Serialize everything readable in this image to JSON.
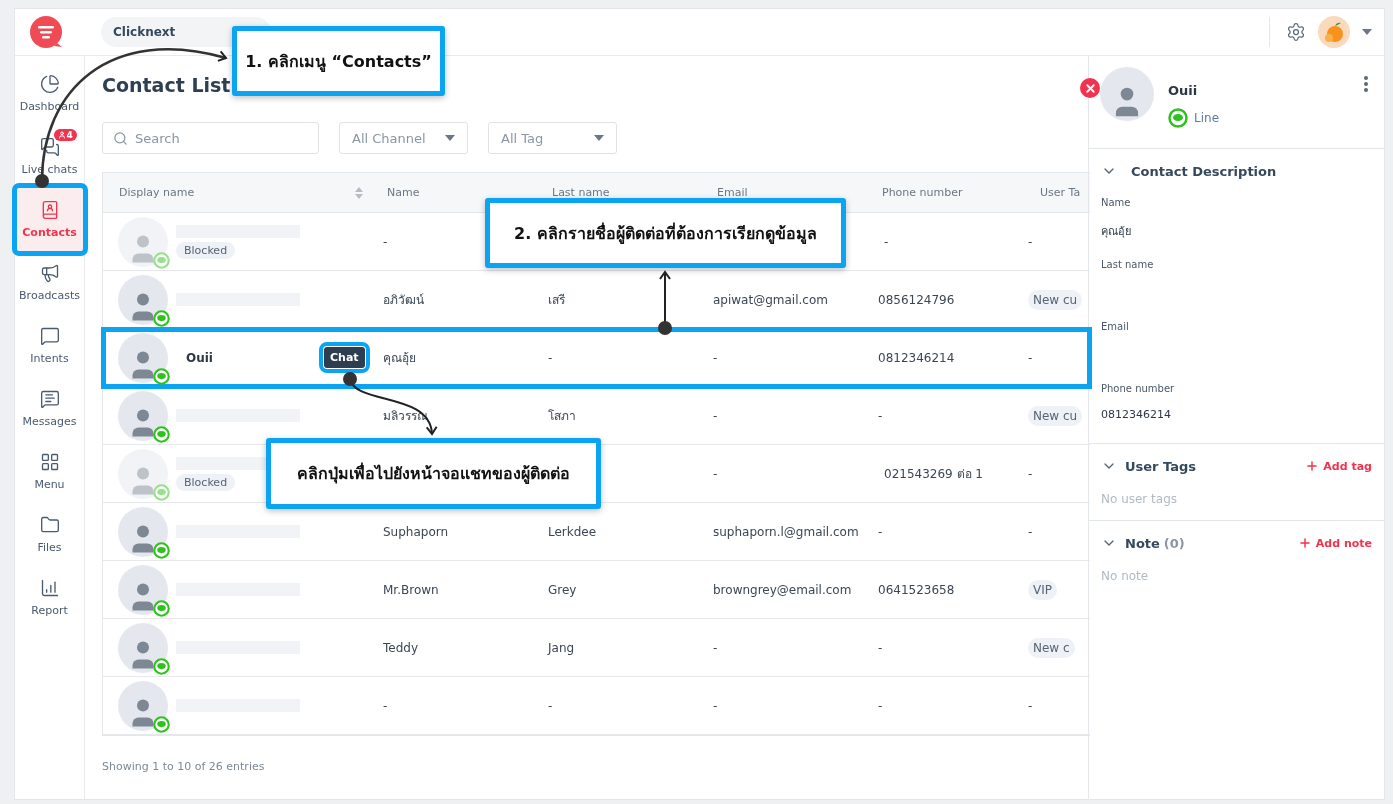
{
  "header": {
    "workspace": "Clicknext"
  },
  "sidebar": {
    "items": [
      {
        "label": "Dashboard",
        "selected": false,
        "highlighted": false
      },
      {
        "label": "Live chats",
        "badge": "4",
        "selected": false,
        "highlighted": false
      },
      {
        "label": "Contacts",
        "selected": true,
        "highlighted": true
      },
      {
        "label": "Broadcasts",
        "selected": false,
        "highlighted": false
      },
      {
        "label": "Intents",
        "selected": false,
        "highlighted": false
      },
      {
        "label": "Messages",
        "selected": false,
        "highlighted": false
      },
      {
        "label": "Menu",
        "selected": false,
        "highlighted": false
      },
      {
        "label": "Files",
        "selected": false,
        "highlighted": false
      },
      {
        "label": "Report",
        "selected": false,
        "highlighted": false
      }
    ]
  },
  "page_title": "Contact List",
  "filters": {
    "search_placeholder": "Search",
    "channel": "All Channel",
    "tag": "All Tag"
  },
  "table": {
    "columns": [
      "Display name",
      "Name",
      "Last name",
      "Email",
      "Phone number",
      "User Ta"
    ],
    "rows": [
      {
        "blocked": true,
        "badge": "Blocked",
        "name": "-",
        "phone": "-",
        "tag": "-",
        "highlighted": false
      },
      {
        "blocked": false,
        "name": "อภิวัฒน์",
        "last_name": "เสรี",
        "email": "apiwat@gmail.com",
        "phone": "0856124796",
        "tag": "New cu",
        "highlighted": false
      },
      {
        "blocked": false,
        "display_name": "Ouii",
        "chat": {
          "label": "Chat",
          "highlighted": true
        },
        "name": "คุณอุ้ย",
        "last_name": "-",
        "email": "-",
        "phone": "0812346214",
        "tag": "-",
        "highlighted": true
      },
      {
        "blocked": false,
        "name": "มลิวรรณ",
        "last_name": "โสภา",
        "email": "-",
        "phone": "-",
        "tag": "New cu",
        "highlighted": false
      },
      {
        "blocked": true,
        "badge": "Blocked",
        "email": "-",
        "phone": "021543269 ต่อ 1",
        "tag": "-",
        "highlighted": false
      },
      {
        "blocked": false,
        "name": "Suphaporn",
        "last_name": "Lerkdee",
        "email": "suphaporn.l@gmail.com",
        "phone": "-",
        "tag": "-",
        "highlighted": false
      },
      {
        "blocked": false,
        "name": "Mr.Brown",
        "last_name": "Grey",
        "email": "browngrey@email.com",
        "phone": "0641523658",
        "tag": "VIP",
        "highlighted": false
      },
      {
        "blocked": false,
        "name": "Teddy",
        "last_name": "Jang",
        "email": "-",
        "phone": "-",
        "tag": "New c",
        "highlighted": false
      },
      {
        "blocked": false,
        "name": "-",
        "last_name": "-",
        "email": "-",
        "phone": "-",
        "tag": "-",
        "highlighted": false
      }
    ]
  },
  "footer": "Showing 1 to 10 of 26 entries",
  "panel": {
    "name": "Ouii",
    "channel": "Line",
    "section_title": "Contact Description",
    "fields": [
      {
        "label": "Name",
        "value": "คุณอุ้ย"
      },
      {
        "label": "Last name"
      },
      {
        "label": "Email"
      },
      {
        "label": "Phone number",
        "value": "0812346214"
      }
    ],
    "tags": {
      "title": "User Tags",
      "action": "Add tag",
      "empty": "No user tags"
    },
    "note": {
      "title": "Note",
      "count": "(0)",
      "action": "Add note",
      "empty": "No note"
    }
  },
  "annotations": [
    {
      "text": "1. คลิกเมนู “Contacts”"
    },
    {
      "text": "2. คลิกรายชื่อผู้ติดต่อที่ต้องการเรียกดูข้อมูล"
    },
    {
      "text": "คลิกปุ่มเพื่อไปยังหน้าจอแชทของผู้ติดต่อ"
    }
  ]
}
